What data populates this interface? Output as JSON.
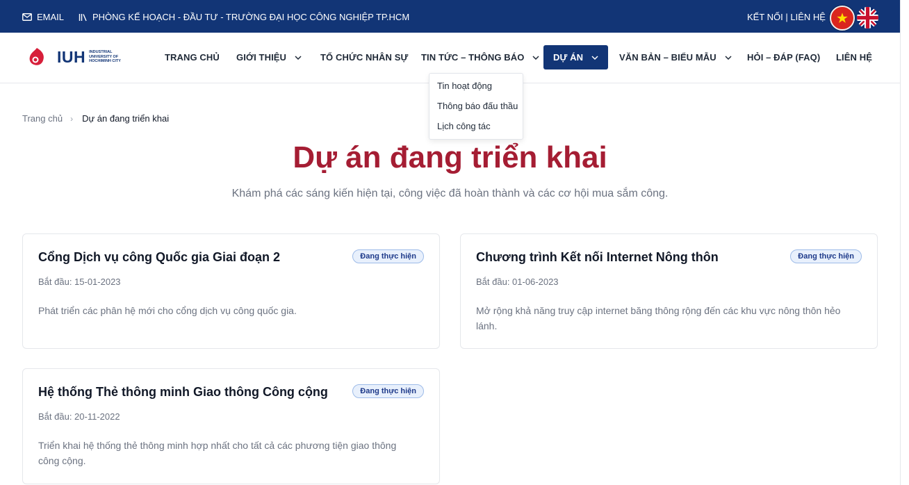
{
  "topbar": {
    "email_label": "EMAIL",
    "office_label": "PHÒNG KẾ HOẠCH - ĐẦU TƯ - TRƯỜNG ĐẠI HỌC CÔNG NGHIỆP TP.HCM",
    "connect_label": "KẾT NỐI | LIÊN HỆ",
    "email_icon": "mail-icon",
    "office_icon": "library-icon"
  },
  "logo": {
    "text": "IUH",
    "sub": "INDUSTRIAL UNIVERSITY OF HOCHIMINH CITY"
  },
  "nav": {
    "items": [
      {
        "label": "TRANG CHỦ"
      },
      {
        "label": "GIỚI THIỆU"
      },
      {
        "label": "TỔ CHỨC NHÂN SỰ"
      },
      {
        "label": "TIN TỨC – THÔNG BÁO"
      },
      {
        "label": "DỰ ÁN"
      },
      {
        "label": "VĂN BẢN – BIỂU MẪU"
      },
      {
        "label": "HỎI – ĐÁP (FAQ)"
      },
      {
        "label": "LIÊN HỆ"
      }
    ]
  },
  "dropdown": {
    "items": [
      "Tin hoạt động",
      "Thông báo đấu thầu",
      "Lịch công tác"
    ]
  },
  "breadcrumb": {
    "home": "Trang chủ",
    "separator": "›",
    "current": "Dự án đang triển khai"
  },
  "hero": {
    "title": "Dự án đang triển khai",
    "subtitle": "Khám phá các sáng kiến hiện tại, công việc đã hoàn thành và các cơ hội mua sắm công."
  },
  "projects": [
    {
      "title": "Cổng Dịch vụ công Quốc gia Giai đoạn 2",
      "status": "Đang thực hiện",
      "date": "Bắt đầu: 15-01-2023",
      "desc": "Phát triển các phân hệ mới cho cổng dịch vụ công quốc gia."
    },
    {
      "title": "Chương trình Kết nối Internet Nông thôn",
      "status": "Đang thực hiện",
      "date": "Bắt đầu: 01-06-2023",
      "desc": "Mở rộng khả năng truy cập internet băng thông rộng đến các khu vực nông thôn hẻo lánh."
    },
    {
      "title": "Hệ thống Thẻ thông minh Giao thông Công cộng",
      "status": "Đang thực hiện",
      "date": "Bắt đầu: 20-11-2022",
      "desc": "Triển khai hệ thống thẻ thông minh hợp nhất cho tất cả các phương tiện giao thông công cộng."
    }
  ],
  "colors": {
    "topbar_bg": "#123576",
    "accent_red": "#a51d33",
    "active_nav": "#123576",
    "badge_bg": "#e8f0fc"
  }
}
